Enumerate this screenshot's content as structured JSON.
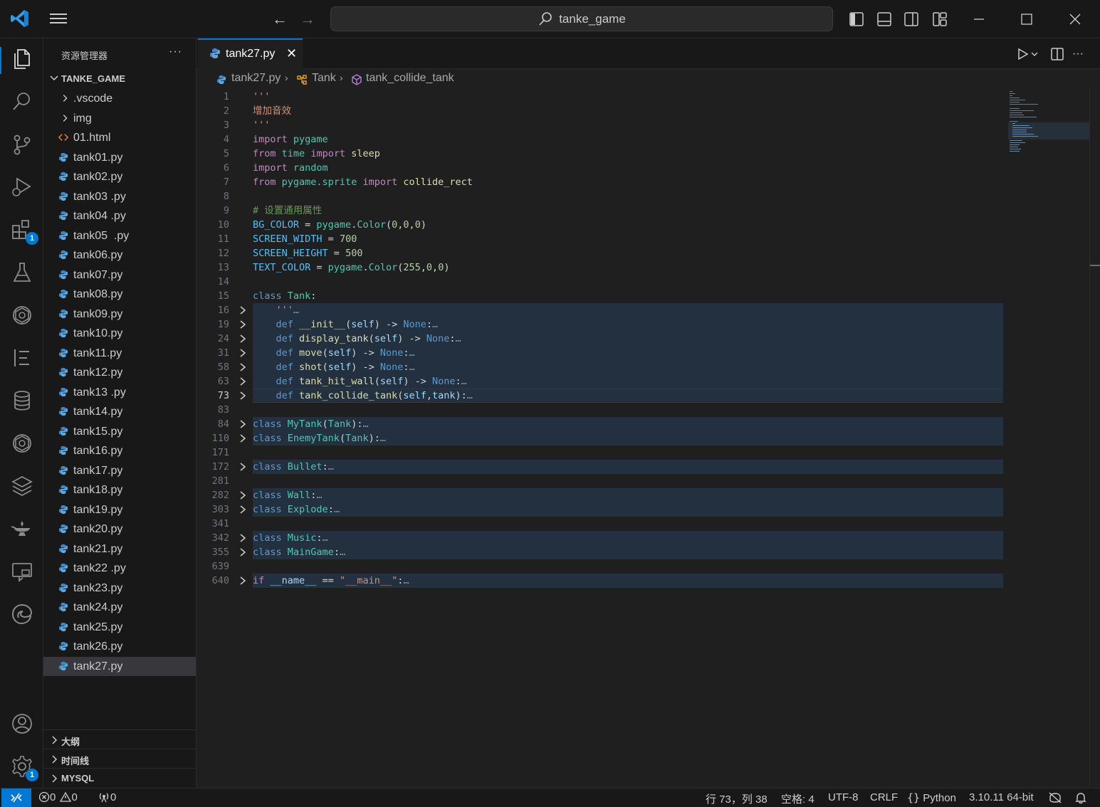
{
  "titlebar": {
    "search_text": "tanke_game",
    "back_icon": "arrow-left-icon",
    "forward_icon": "arrow-right-icon"
  },
  "activity": {
    "extensions_badge": "1",
    "settings_badge": "1"
  },
  "sidebar": {
    "title": "资源管理器",
    "more": "···",
    "folder_name": "TANKE_GAME",
    "items": [
      {
        "label": ".vscode",
        "type": "folder"
      },
      {
        "label": "img",
        "type": "folder"
      },
      {
        "label": "01.html",
        "type": "html"
      },
      {
        "label": "tank01.py",
        "type": "py"
      },
      {
        "label": "tank02.py",
        "type": "py"
      },
      {
        "label": "tank03 .py",
        "type": "py"
      },
      {
        "label": "tank04 .py",
        "type": "py"
      },
      {
        "label": "tank05  .py",
        "type": "py"
      },
      {
        "label": "tank06.py",
        "type": "py"
      },
      {
        "label": "tank07.py",
        "type": "py"
      },
      {
        "label": "tank08.py",
        "type": "py"
      },
      {
        "label": "tank09.py",
        "type": "py"
      },
      {
        "label": "tank10.py",
        "type": "py"
      },
      {
        "label": "tank11.py",
        "type": "py"
      },
      {
        "label": "tank12.py",
        "type": "py"
      },
      {
        "label": "tank13 .py",
        "type": "py"
      },
      {
        "label": "tank14.py",
        "type": "py"
      },
      {
        "label": "tank15.py",
        "type": "py"
      },
      {
        "label": "tank16.py",
        "type": "py"
      },
      {
        "label": "tank17.py",
        "type": "py"
      },
      {
        "label": "tank18.py",
        "type": "py"
      },
      {
        "label": "tank19.py",
        "type": "py"
      },
      {
        "label": "tank20.py",
        "type": "py"
      },
      {
        "label": "tank21.py",
        "type": "py"
      },
      {
        "label": "tank22 .py",
        "type": "py"
      },
      {
        "label": "tank23.py",
        "type": "py"
      },
      {
        "label": "tank24.py",
        "type": "py"
      },
      {
        "label": "tank25.py",
        "type": "py"
      },
      {
        "label": "tank26.py",
        "type": "py"
      },
      {
        "label": "tank27.py",
        "type": "py",
        "active": true
      }
    ],
    "sections": [
      "大纲",
      "时间线",
      "MYSQL"
    ]
  },
  "editor": {
    "tab_label": "tank27.py",
    "tab_close": "✕",
    "breadcrumb": {
      "file": "tank27.py",
      "class": "Tank",
      "method": "tank_collide_tank"
    },
    "active_line": "73",
    "lines": [
      {
        "n": "1",
        "tokens": [
          [
            "str",
            "'''"
          ]
        ]
      },
      {
        "n": "2",
        "tokens": [
          [
            "str",
            "增加音效"
          ]
        ]
      },
      {
        "n": "3",
        "tokens": [
          [
            "str",
            "'''"
          ]
        ]
      },
      {
        "n": "4",
        "tokens": [
          [
            "ctl",
            "import"
          ],
          [
            "plain",
            " "
          ],
          [
            "ty",
            "pygame"
          ]
        ]
      },
      {
        "n": "5",
        "tokens": [
          [
            "ctl",
            "from"
          ],
          [
            "plain",
            " "
          ],
          [
            "ty",
            "time"
          ],
          [
            "plain",
            " "
          ],
          [
            "ctl",
            "import"
          ],
          [
            "plain",
            " "
          ],
          [
            "fn",
            "sleep"
          ]
        ]
      },
      {
        "n": "6",
        "tokens": [
          [
            "ctl",
            "import"
          ],
          [
            "plain",
            " "
          ],
          [
            "ty",
            "random"
          ]
        ]
      },
      {
        "n": "7",
        "tokens": [
          [
            "ctl",
            "from"
          ],
          [
            "plain",
            " "
          ],
          [
            "ty",
            "pygame.sprite"
          ],
          [
            "plain",
            " "
          ],
          [
            "ctl",
            "import"
          ],
          [
            "plain",
            " "
          ],
          [
            "fn",
            "collide_rect"
          ]
        ]
      },
      {
        "n": "8",
        "tokens": []
      },
      {
        "n": "9",
        "tokens": [
          [
            "com",
            "# 设置通用属性"
          ]
        ]
      },
      {
        "n": "10",
        "tokens": [
          [
            "const",
            "BG_COLOR"
          ],
          [
            "plain",
            " = "
          ],
          [
            "ty",
            "pygame"
          ],
          [
            "plain",
            "."
          ],
          [
            "ty",
            "Color"
          ],
          [
            "plain",
            "("
          ],
          [
            "num",
            "0"
          ],
          [
            "plain",
            ","
          ],
          [
            "num",
            "0"
          ],
          [
            "plain",
            ","
          ],
          [
            "num",
            "0"
          ],
          [
            "plain",
            ")"
          ]
        ]
      },
      {
        "n": "11",
        "tokens": [
          [
            "const",
            "SCREEN_WIDTH"
          ],
          [
            "plain",
            " = "
          ],
          [
            "num",
            "700"
          ]
        ]
      },
      {
        "n": "12",
        "tokens": [
          [
            "const",
            "SCREEN_HEIGHT"
          ],
          [
            "plain",
            " = "
          ],
          [
            "num",
            "500"
          ]
        ]
      },
      {
        "n": "13",
        "tokens": [
          [
            "const",
            "TEXT_COLOR"
          ],
          [
            "plain",
            " = "
          ],
          [
            "ty",
            "pygame"
          ],
          [
            "plain",
            "."
          ],
          [
            "ty",
            "Color"
          ],
          [
            "plain",
            "("
          ],
          [
            "num",
            "255"
          ],
          [
            "plain",
            ","
          ],
          [
            "num",
            "0"
          ],
          [
            "plain",
            ","
          ],
          [
            "num",
            "0"
          ],
          [
            "plain",
            ")"
          ]
        ]
      },
      {
        "n": "14",
        "tokens": []
      },
      {
        "n": "15",
        "tokens": [
          [
            "kw",
            "class"
          ],
          [
            "plain",
            " "
          ],
          [
            "ty",
            "Tank"
          ],
          [
            "plain",
            ":"
          ]
        ]
      },
      {
        "n": "16",
        "fold": true,
        "hl": true,
        "tokens": [
          [
            "plain",
            "    "
          ],
          [
            "str",
            "'''"
          ],
          [
            "dots",
            "…"
          ]
        ]
      },
      {
        "n": "19",
        "fold": true,
        "hl": true,
        "tokens": [
          [
            "plain",
            "    "
          ],
          [
            "kw",
            "def"
          ],
          [
            "plain",
            " "
          ],
          [
            "fn",
            "__init__"
          ],
          [
            "plain",
            "("
          ],
          [
            "var",
            "self"
          ],
          [
            "plain",
            ") -> "
          ],
          [
            "kw",
            "None"
          ],
          [
            "plain",
            ":"
          ],
          [
            "dots",
            "…"
          ]
        ]
      },
      {
        "n": "24",
        "fold": true,
        "hl": true,
        "tokens": [
          [
            "plain",
            "    "
          ],
          [
            "kw",
            "def"
          ],
          [
            "plain",
            " "
          ],
          [
            "fn",
            "display_tank"
          ],
          [
            "plain",
            "("
          ],
          [
            "var",
            "self"
          ],
          [
            "plain",
            ") -> "
          ],
          [
            "kw",
            "None"
          ],
          [
            "plain",
            ":"
          ],
          [
            "dots",
            "…"
          ]
        ]
      },
      {
        "n": "31",
        "fold": true,
        "hl": true,
        "tokens": [
          [
            "plain",
            "    "
          ],
          [
            "kw",
            "def"
          ],
          [
            "plain",
            " "
          ],
          [
            "fn",
            "move"
          ],
          [
            "plain",
            "("
          ],
          [
            "var",
            "self"
          ],
          [
            "plain",
            ") -> "
          ],
          [
            "kw",
            "None"
          ],
          [
            "plain",
            ":"
          ],
          [
            "dots",
            "…"
          ]
        ]
      },
      {
        "n": "58",
        "fold": true,
        "hl": true,
        "tokens": [
          [
            "plain",
            "    "
          ],
          [
            "kw",
            "def"
          ],
          [
            "plain",
            " "
          ],
          [
            "fn",
            "shot"
          ],
          [
            "plain",
            "("
          ],
          [
            "var",
            "self"
          ],
          [
            "plain",
            ") -> "
          ],
          [
            "kw",
            "None"
          ],
          [
            "plain",
            ":"
          ],
          [
            "dots",
            "…"
          ]
        ]
      },
      {
        "n": "63",
        "fold": true,
        "hl": true,
        "tokens": [
          [
            "plain",
            "    "
          ],
          [
            "kw",
            "def"
          ],
          [
            "plain",
            " "
          ],
          [
            "fn",
            "tank_hit_wall"
          ],
          [
            "plain",
            "("
          ],
          [
            "var",
            "self"
          ],
          [
            "plain",
            ") -> "
          ],
          [
            "kw",
            "None"
          ],
          [
            "plain",
            ":"
          ],
          [
            "dots",
            "…"
          ]
        ]
      },
      {
        "n": "73",
        "fold": true,
        "hl": true,
        "cur": true,
        "tokens": [
          [
            "plain",
            "    "
          ],
          [
            "kw",
            "def"
          ],
          [
            "plain",
            " "
          ],
          [
            "fn",
            "tank_collide_tank"
          ],
          [
            "plain",
            "("
          ],
          [
            "var",
            "self"
          ],
          [
            "plain",
            ","
          ],
          [
            "var",
            "tank"
          ],
          [
            "plain",
            "):"
          ],
          [
            "dots",
            "…"
          ]
        ]
      },
      {
        "n": "83",
        "tokens": []
      },
      {
        "n": "84",
        "fold": true,
        "hl": true,
        "tokens": [
          [
            "kw",
            "class"
          ],
          [
            "plain",
            " "
          ],
          [
            "ty",
            "MyTank"
          ],
          [
            "plain",
            "("
          ],
          [
            "ty",
            "Tank"
          ],
          [
            "plain",
            "):"
          ],
          [
            "dots",
            "…"
          ]
        ]
      },
      {
        "n": "110",
        "fold": true,
        "hl": true,
        "tokens": [
          [
            "kw",
            "class"
          ],
          [
            "plain",
            " "
          ],
          [
            "ty",
            "EnemyTank"
          ],
          [
            "plain",
            "("
          ],
          [
            "ty",
            "Tank"
          ],
          [
            "plain",
            "):"
          ],
          [
            "dots",
            "…"
          ]
        ]
      },
      {
        "n": "171",
        "tokens": []
      },
      {
        "n": "172",
        "fold": true,
        "hl": true,
        "tokens": [
          [
            "kw",
            "class"
          ],
          [
            "plain",
            " "
          ],
          [
            "ty",
            "Bullet"
          ],
          [
            "plain",
            ":"
          ],
          [
            "dots",
            "…"
          ]
        ]
      },
      {
        "n": "281",
        "tokens": []
      },
      {
        "n": "282",
        "fold": true,
        "hl": true,
        "tokens": [
          [
            "kw",
            "class"
          ],
          [
            "plain",
            " "
          ],
          [
            "ty",
            "Wall"
          ],
          [
            "plain",
            ":"
          ],
          [
            "dots",
            "…"
          ]
        ]
      },
      {
        "n": "303",
        "fold": true,
        "hl": true,
        "tokens": [
          [
            "kw",
            "class"
          ],
          [
            "plain",
            " "
          ],
          [
            "ty",
            "Explode"
          ],
          [
            "plain",
            ":"
          ],
          [
            "dots",
            "…"
          ]
        ]
      },
      {
        "n": "341",
        "tokens": []
      },
      {
        "n": "342",
        "fold": true,
        "hl": true,
        "tokens": [
          [
            "kw",
            "class"
          ],
          [
            "plain",
            " "
          ],
          [
            "ty",
            "Music"
          ],
          [
            "plain",
            ":"
          ],
          [
            "dots",
            "…"
          ]
        ]
      },
      {
        "n": "355",
        "fold": true,
        "hl": true,
        "tokens": [
          [
            "kw",
            "class"
          ],
          [
            "plain",
            " "
          ],
          [
            "ty",
            "MainGame"
          ],
          [
            "plain",
            ":"
          ],
          [
            "dots",
            "…"
          ]
        ]
      },
      {
        "n": "639",
        "tokens": []
      },
      {
        "n": "640",
        "fold": true,
        "hl": true,
        "tokens": [
          [
            "ctl",
            "if"
          ],
          [
            "plain",
            " "
          ],
          [
            "var",
            "__name__"
          ],
          [
            "plain",
            " == "
          ],
          [
            "str",
            "\"__main__\""
          ],
          [
            "plain",
            ":"
          ],
          [
            "dots",
            "…"
          ]
        ]
      }
    ]
  },
  "statusbar": {
    "errors": "0",
    "warnings": "0",
    "ports": "0",
    "position": "行 73，列 38",
    "indent": "空格: 4",
    "encoding": "UTF-8",
    "eol": "CRLF",
    "language": "Python",
    "interpreter": "3.10.11 64-bit"
  },
  "colors": {
    "accent": "#0078d4",
    "background": "#1f1f1f",
    "chrome": "#181818"
  }
}
